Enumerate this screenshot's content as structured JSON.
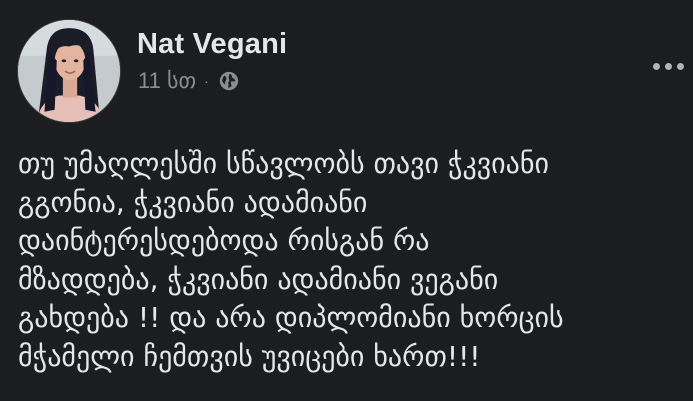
{
  "post": {
    "author": "Nat Vegani",
    "timestamp": "11 სთ",
    "separator": "·",
    "privacy_icon": "globe-icon",
    "more_icon": "more-options-icon",
    "text": "თუ უმაღლესში სწავლობს თავი ჭკვიანი\nგგონია, ჭკვიანი ადამიანი\nდაინტერესდებოდა რისგან რა\nმზადდება, ჭკვიანი ადამიანი ვეგანი\nგახდება !! და არა დიპლომიანი ხორცის\nმჭამელი ჩემთვის უვიცები ხართ!!!"
  },
  "colors": {
    "background": "#1c1d1f",
    "primary_text": "#e4e6eb",
    "secondary_text": "#8a8d91"
  }
}
